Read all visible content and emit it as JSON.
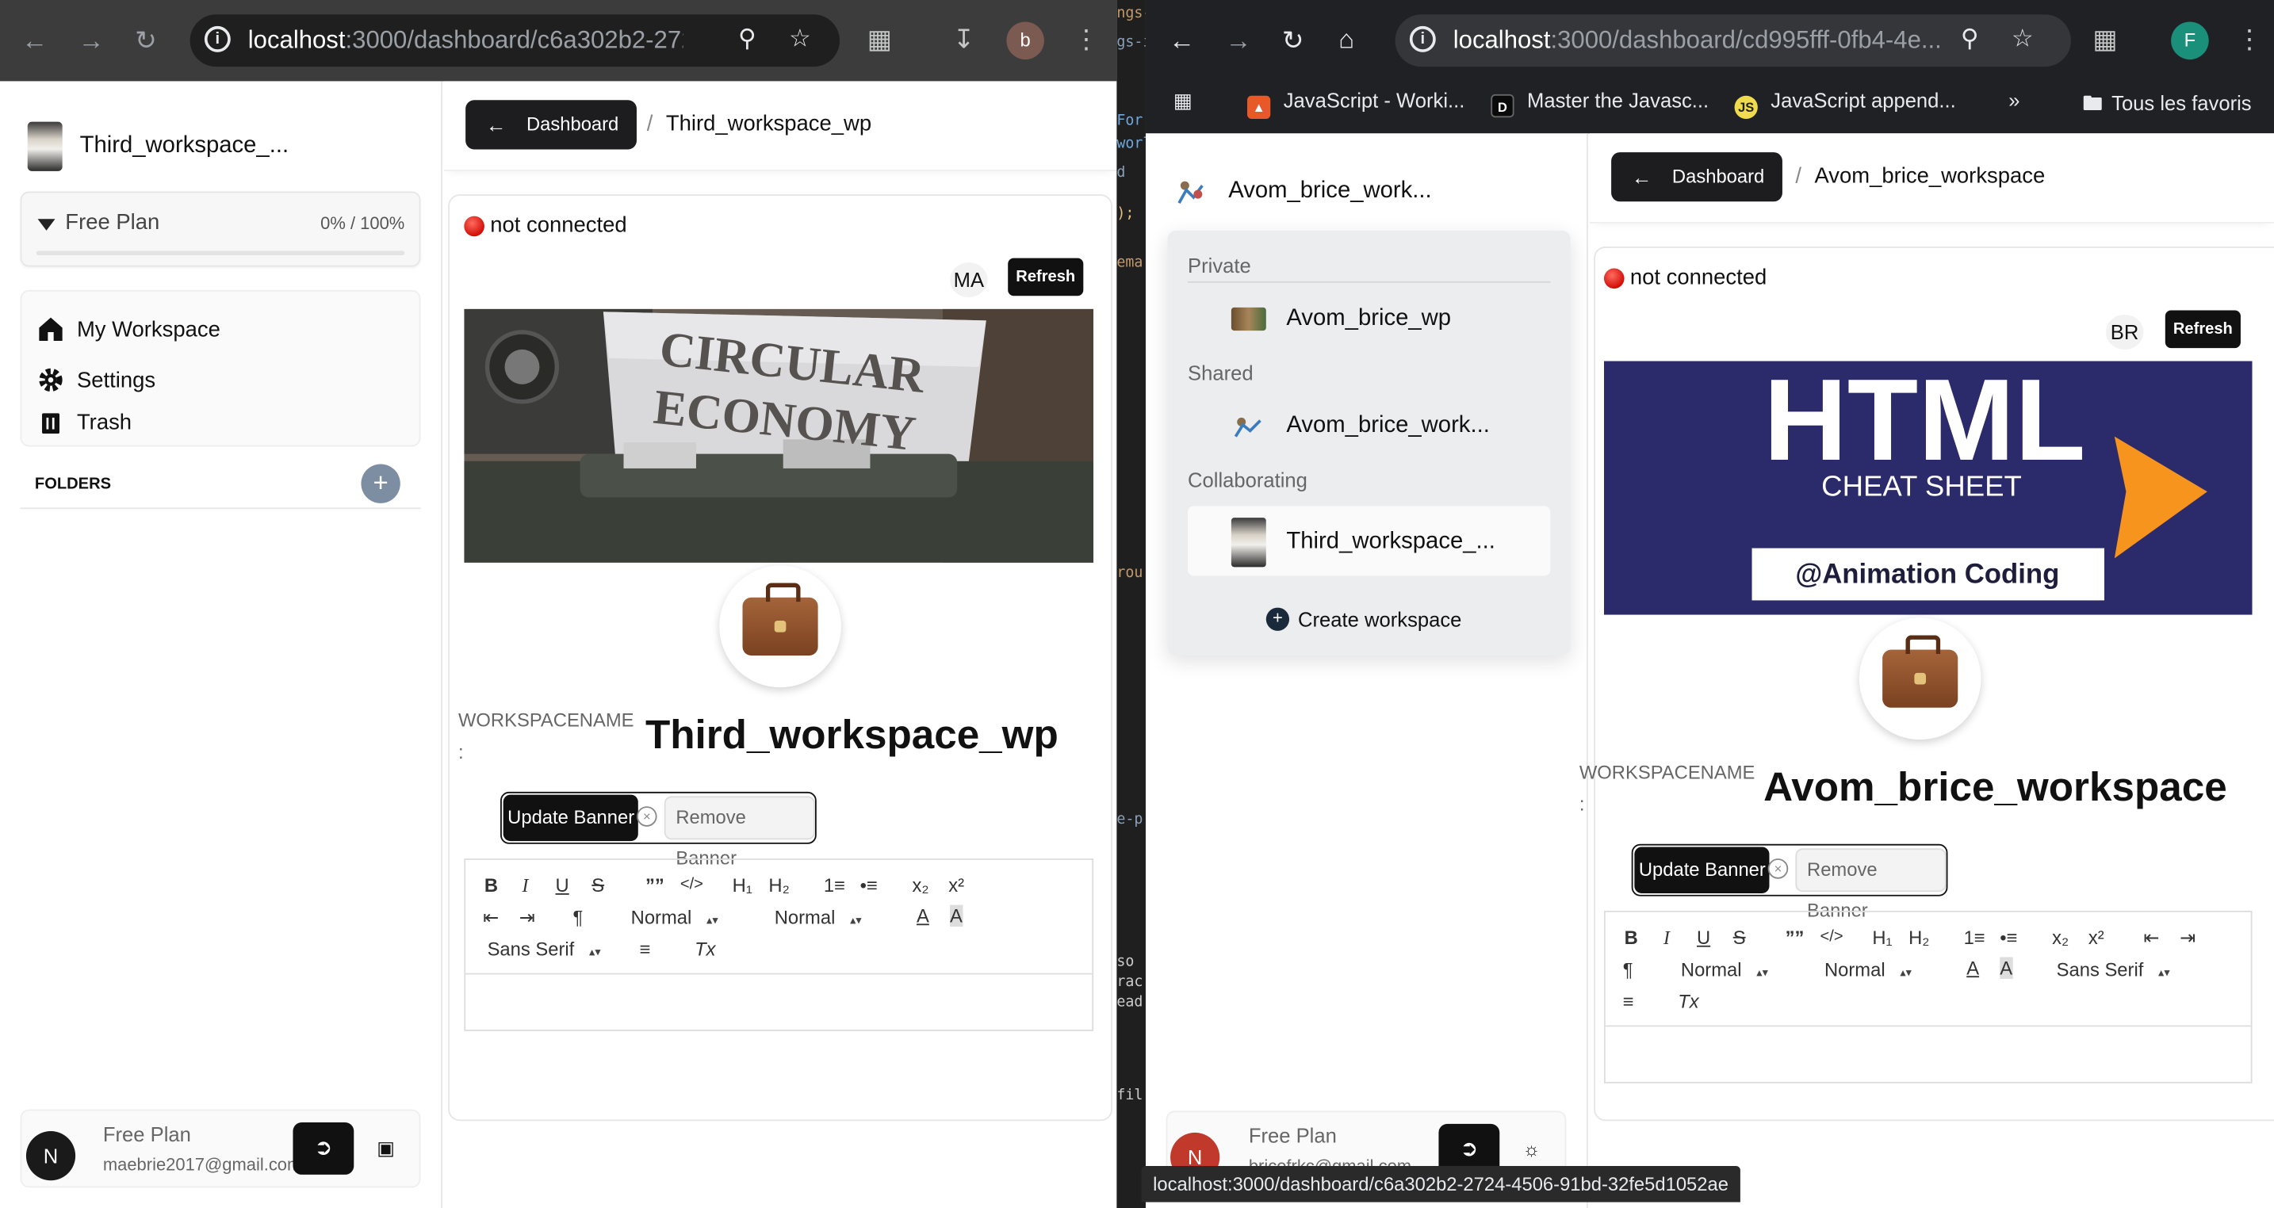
{
  "left_window": {
    "url_host": "localhost",
    "url_rest": ":3000/dashboard/c6a302b2-2724...",
    "profile_initial": "b",
    "sidebar": {
      "workspace_name": "Third_workspace_...",
      "plan_label": "Free Plan",
      "plan_usage": "0% / 100%",
      "nav": [
        {
          "label": "My Workspace"
        },
        {
          "label": "Settings"
        },
        {
          "label": "Trash"
        }
      ],
      "folders_label": "FOLDERS",
      "add_folder": "+",
      "user_initial": "N",
      "user_plan": "Free Plan",
      "user_email": "maebrie2017@gmail.com"
    },
    "main": {
      "back_label": "Dashboard",
      "breadcrumb": "Third_workspace_wp",
      "status": "not connected",
      "collaborator_initials": "MA",
      "refresh_label": "Refresh",
      "banner_line1": "CIRCULAR",
      "banner_line2": "ECONOMY",
      "workspace_label": "WORKSPACENAME",
      "colon": ":",
      "workspace_name": "Third_workspace_wp",
      "update_banner": "Update Banner",
      "remove_banner": "Remove Banner"
    }
  },
  "right_window": {
    "url_host": "localhost",
    "url_rest": ":3000/dashboard/cd995fff-0fb4-4e...",
    "profile_initial": "F",
    "bookmarks": [
      {
        "label": "JavaScript - Worki..."
      },
      {
        "label": "Master the Javasc..."
      },
      {
        "label": "JavaScript append..."
      }
    ],
    "more_bookmarks": "»",
    "all_bookmarks": "Tous les favoris",
    "sidebar": {
      "workspace_name": "Avom_brice_work...",
      "dropdown": {
        "private_label": "Private",
        "private_item": "Avom_brice_wp",
        "shared_label": "Shared",
        "shared_item": "Avom_brice_work...",
        "collab_label": "Collaborating",
        "collab_item": "Third_workspace_...",
        "create_label": "Create workspace"
      },
      "user_initial": "N",
      "user_plan": "Free Plan",
      "user_email": "bricefrkc@gmail.com"
    },
    "main": {
      "back_label": "Dashboard",
      "breadcrumb": "Avom_brice_workspace",
      "status": "not connected",
      "collaborator_initials": "BR",
      "refresh_label": "Refresh",
      "banner_title": "HTML",
      "banner_sub": "CHEAT SHEET",
      "banner_tag": "@Animation Coding",
      "workspace_label": "WORKSPACENAME",
      "colon": ":",
      "workspace_name": "Avom_brice_workspace",
      "update_banner": "Update Banner",
      "remove_banner": "Remove Banner"
    }
  },
  "editor_toolbar": {
    "bold": "B",
    "italic": "I",
    "underline": "U",
    "strike": "S",
    "quote": "””",
    "code": "</>",
    "h1": "H₁",
    "h2": "H₂",
    "ol": "1≡",
    "ul": "•≡",
    "sub": "x₂",
    "sup": "x²",
    "outdent": "⇤",
    "indent": "⇥",
    "rtl": "¶",
    "size": "Normal",
    "header": "Normal",
    "font": "Sans Serif",
    "color": "A",
    "bg": "A",
    "align": "≡",
    "clean": "Tx"
  },
  "status_bar_url": "localhost:3000/dashboard/c6a302b2-2724-4506-91bd-32fe5d1052ae",
  "colors": {
    "primary_button": "#111111",
    "status_red": "#d20f08",
    "html_banner_bg": "#2b2a6b",
    "html_banner_orange": "#f7941d"
  }
}
